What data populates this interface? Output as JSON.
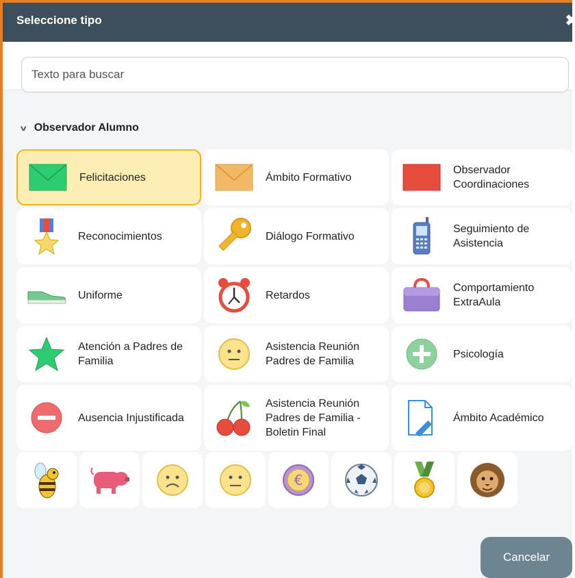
{
  "dialog": {
    "title": "Seleccione tipo",
    "close_glyph": "✖"
  },
  "search": {
    "placeholder": "Texto para buscar",
    "value": ""
  },
  "section": {
    "label": "Observador Alumno",
    "chevron": "v"
  },
  "items": [
    {
      "label": "Felicitaciones",
      "icon": "green-envelope-icon",
      "selected": true
    },
    {
      "label": "Ámbito Formativo",
      "icon": "orange-envelope-icon"
    },
    {
      "label": "Observador Coordinaciones",
      "icon": "red-rectangle-icon"
    },
    {
      "label": "Reconocimientos",
      "icon": "medal-star-icon"
    },
    {
      "label": "Diálogo Formativo",
      "icon": "key-icon"
    },
    {
      "label": "Seguimiento de Asistencia",
      "icon": "phone-icon"
    },
    {
      "label": "Uniforme",
      "icon": "shoe-icon"
    },
    {
      "label": "Retardos",
      "icon": "alarm-clock-icon"
    },
    {
      "label": "Comportamiento ExtraAula",
      "icon": "briefcase-icon"
    },
    {
      "label": "Atención a Padres de Familia",
      "icon": "green-star-icon"
    },
    {
      "label": "Asistencia Reunión Padres de Familia",
      "icon": "neutral-face-icon"
    },
    {
      "label": "Psicología",
      "icon": "plus-circle-icon"
    },
    {
      "label": "Ausencia Injustificada",
      "icon": "minus-circle-icon"
    },
    {
      "label": "Asistencia Reunión Padres de Familia - Boletin Final",
      "icon": "cherries-icon"
    },
    {
      "label": "Ámbito Académico",
      "icon": "document-pen-icon"
    }
  ],
  "small_items": [
    {
      "icon": "bee-icon"
    },
    {
      "icon": "pig-icon"
    },
    {
      "icon": "sad-face-icon"
    },
    {
      "icon": "neutral-face-icon"
    },
    {
      "icon": "euro-coin-icon"
    },
    {
      "icon": "soccer-ball-icon"
    },
    {
      "icon": "gold-medal-icon"
    },
    {
      "icon": "lion-icon"
    }
  ],
  "footer": {
    "cancel_label": "Cancelar"
  }
}
